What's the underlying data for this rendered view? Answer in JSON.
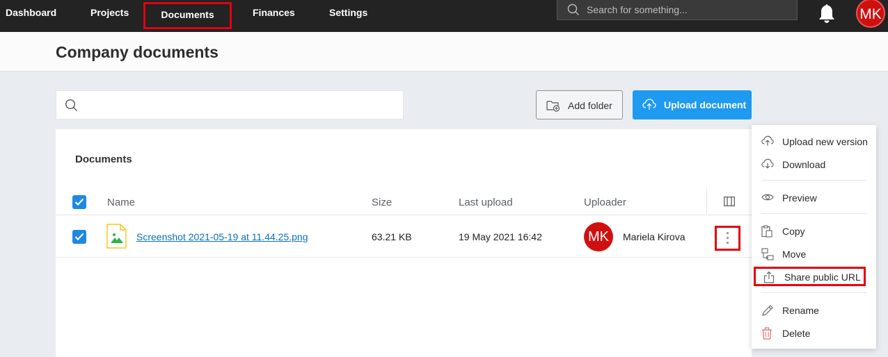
{
  "nav": {
    "items": [
      {
        "label": "Dashboard",
        "active": false
      },
      {
        "label": "Projects",
        "active": false
      },
      {
        "label": "Documents",
        "active": true
      },
      {
        "label": "Finances",
        "active": false
      },
      {
        "label": "Settings",
        "active": false
      }
    ],
    "search_placeholder": "Search for something...",
    "avatar_initials": "MK"
  },
  "page": {
    "title": "Company documents"
  },
  "toolbar": {
    "search_placeholder": "",
    "add_folder_label": "Add folder",
    "upload_label": "Upload document"
  },
  "documents": {
    "title": "Documents",
    "columns": {
      "name": "Name",
      "size": "Size",
      "last_upload": "Last upload",
      "uploader": "Uploader"
    },
    "rows": [
      {
        "name": "Screenshot 2021-05-19 at 11.44.25.png",
        "size": "63.21 KB",
        "last_upload": "19 May 2021 16:42",
        "uploader_initials": "MK",
        "uploader_name": "Mariela Kirova",
        "checked": true
      }
    ]
  },
  "context_menu": {
    "items": [
      {
        "label": "Upload new version",
        "icon": "cloud-upload-icon"
      },
      {
        "label": "Download",
        "icon": "cloud-download-icon"
      },
      {
        "label": "Preview",
        "icon": "eye-icon"
      },
      {
        "label": "Copy",
        "icon": "copy-icon"
      },
      {
        "label": "Move",
        "icon": "move-icon"
      },
      {
        "label": "Share public URL",
        "icon": "share-icon"
      },
      {
        "label": "Rename",
        "icon": "pencil-icon"
      },
      {
        "label": "Delete",
        "icon": "trash-icon"
      }
    ]
  },
  "colors": {
    "accent": "#1e9af0",
    "highlight": "#e3000f",
    "avatar": "#d0100f",
    "topbar": "#232323"
  }
}
